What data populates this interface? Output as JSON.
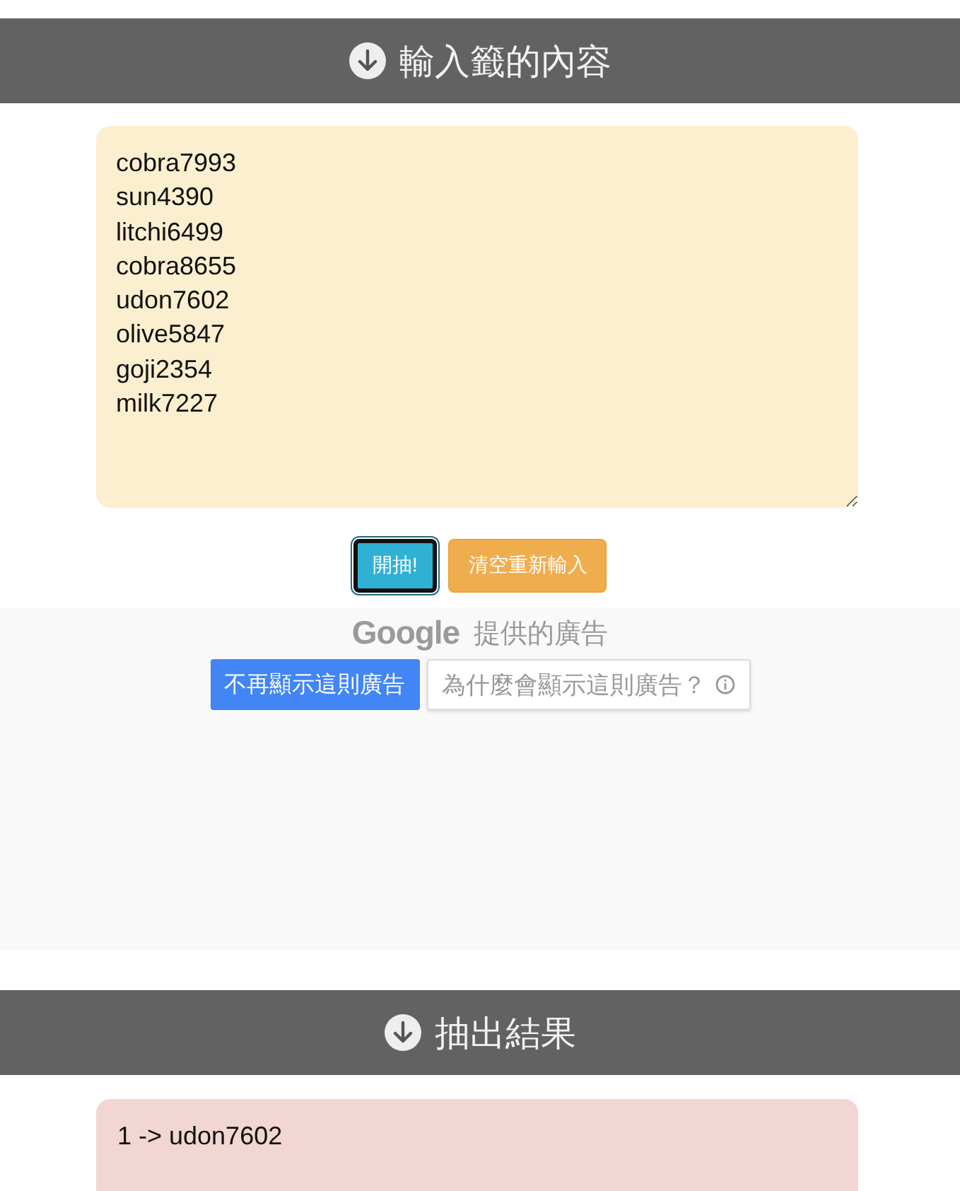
{
  "input_section": {
    "title": "輸入籤的內容",
    "entries": [
      "cobra7993",
      "sun4390",
      "litchi6499",
      "cobra8655",
      "udon7602",
      "olive5847",
      "goji2354",
      "milk7227"
    ]
  },
  "buttons": [
    {
      "label": "開抽!",
      "kind": "primary",
      "focused": true
    },
    {
      "label": "清空重新輸入",
      "kind": "warning",
      "focused": false
    }
  ],
  "ad": {
    "brand": "Google",
    "caption": "提供的廣告",
    "buttons": [
      {
        "label": "不再顯示這則廣告",
        "kind": "solid"
      },
      {
        "label": "為什麼會顯示這則廣告？",
        "kind": "outline"
      }
    ]
  },
  "result_section": {
    "title": "抽出結果",
    "results": [
      "1 -> udon7602"
    ]
  }
}
